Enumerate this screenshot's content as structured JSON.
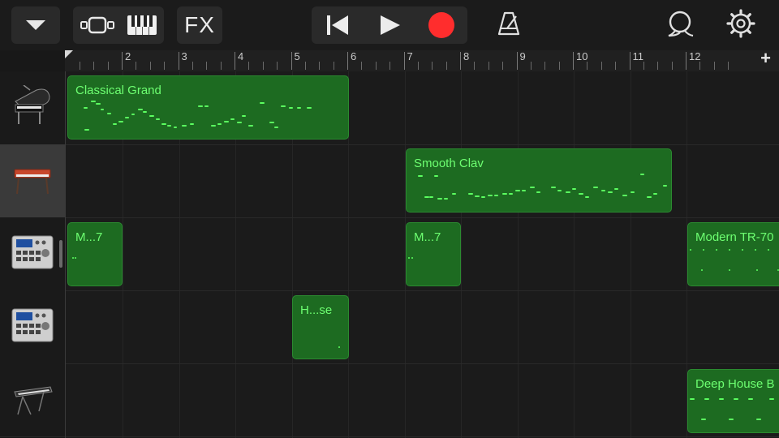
{
  "toolbar": {
    "fx_label": "FX",
    "record_color": "#ff2d2d",
    "icons": [
      "chevron-down-icon",
      "tracks-view-icon",
      "keyboard-icon",
      "rewind-icon",
      "play-icon",
      "record-icon",
      "metronome-icon",
      "loop-icon",
      "settings-gear-icon"
    ]
  },
  "ruler": {
    "bars": [
      "2",
      "3",
      "4",
      "5",
      "6",
      "7",
      "8",
      "9",
      "10",
      "11",
      "12"
    ],
    "add_symbol": "+"
  },
  "tracks": [
    {
      "instrument": "grand-piano",
      "selected": false
    },
    {
      "instrument": "electric-piano",
      "selected": true
    },
    {
      "instrument": "drum-machine",
      "selected": false
    },
    {
      "instrument": "drum-machine",
      "selected": false
    },
    {
      "instrument": "synth-keyboard",
      "selected": false
    }
  ],
  "regions": [
    {
      "track": 0,
      "name": "Classical Grand"
    },
    {
      "track": 1,
      "name": "Smooth Clav"
    },
    {
      "track": 2,
      "name": "M...7"
    },
    {
      "track": 2,
      "name": "M...7"
    },
    {
      "track": 2,
      "name": "Modern TR-70"
    },
    {
      "track": 3,
      "name": "H...se"
    },
    {
      "track": 4,
      "name": "Deep House B"
    }
  ],
  "colors": {
    "region_fill": "#1d6b21",
    "region_text": "#6dff71",
    "note": "#5bff60"
  }
}
